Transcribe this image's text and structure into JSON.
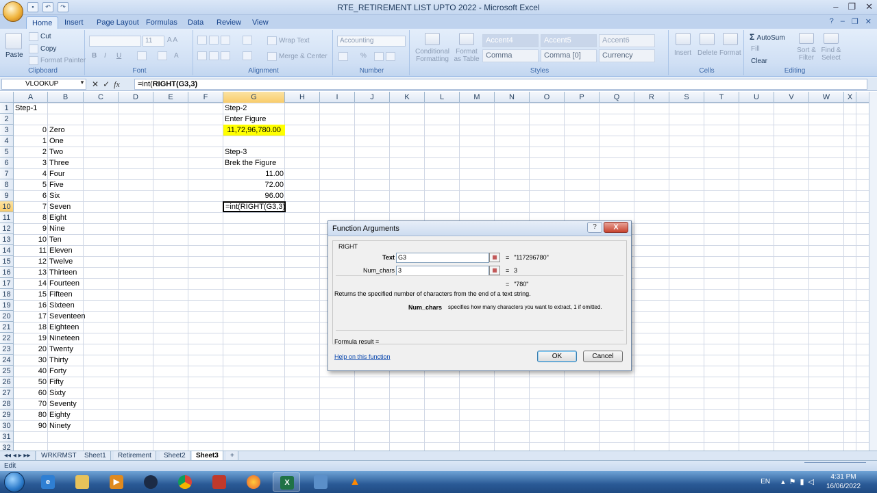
{
  "window": {
    "title": "RTE_RETIREMENT LIST UPTO 2022 - Microsoft Excel",
    "office_button": "Office"
  },
  "ribbon": {
    "tabs": [
      "Home",
      "Insert",
      "Page Layout",
      "Formulas",
      "Data",
      "Review",
      "View"
    ],
    "clipboard": {
      "label": "Clipboard",
      "paste": "Paste",
      "cut": "Cut",
      "copy": "Copy",
      "format_painter": "Format Painter"
    },
    "font": {
      "label": "Font",
      "size": "11"
    },
    "alignment": {
      "label": "Alignment",
      "wrap_text": "Wrap Text",
      "merge_center": "Merge & Center"
    },
    "number": {
      "label": "Number",
      "format": "Accounting",
      "percent": "%"
    },
    "styles": {
      "label": "Styles",
      "conditional": "Conditional Formatting",
      "format_table": "Format as Table",
      "cells": [
        "Accent4",
        "Accent5",
        "Accent6",
        "Comma",
        "Comma [0]",
        "Currency"
      ]
    },
    "cells": {
      "label": "Cells",
      "insert": "Insert",
      "delete": "Delete",
      "format": "Format"
    },
    "editing": {
      "label": "Editing",
      "autosum": "AutoSum",
      "fill": "Fill",
      "clear": "Clear",
      "sort_filter": "Sort & Filter",
      "find_select": "Find & Select"
    }
  },
  "formula_bar": {
    "name_box": "VLOOKUP",
    "fx": "fx",
    "formula_prefix": "=int(",
    "formula_bold": "RIGHT(G3,3)"
  },
  "grid": {
    "columns": [
      "A",
      "B",
      "C",
      "D",
      "E",
      "F",
      "G",
      "H",
      "I",
      "J",
      "K",
      "L",
      "M",
      "N",
      "O",
      "P",
      "Q",
      "R",
      "S",
      "T",
      "U",
      "V",
      "W",
      "X"
    ],
    "rows": [
      "1",
      "2",
      "3",
      "4",
      "5",
      "6",
      "7",
      "8",
      "9",
      "10",
      "11",
      "12",
      "13",
      "14",
      "15",
      "16",
      "17",
      "18",
      "19",
      "20",
      "21",
      "22",
      "23",
      "24",
      "25",
      "26",
      "27",
      "28",
      "29",
      "30",
      "31",
      "32"
    ],
    "col_a": [
      "Step-1",
      "",
      "0",
      "1",
      "2",
      "3",
      "4",
      "5",
      "6",
      "7",
      "8",
      "9",
      "10",
      "11",
      "12",
      "13",
      "14",
      "15",
      "16",
      "17",
      "18",
      "19",
      "20",
      "30",
      "40",
      "50",
      "60",
      "70",
      "80",
      "90"
    ],
    "col_b": [
      "",
      "",
      "Zero",
      "One",
      "Two",
      "Three",
      "Four",
      "Five",
      "Six",
      "Seven",
      "Eight",
      "Nine",
      "Ten",
      "Eleven",
      "Twelve",
      "Thirteen",
      "Fourteen",
      "Fifteen",
      "Sixteen",
      "Seventeen",
      "Eighteen",
      "Nineteen",
      "Twenty",
      "Thirty",
      "Forty",
      "Fifty",
      "Sixty",
      "Seventy",
      "Eighty",
      "Ninety"
    ],
    "g": {
      "g1": "Step-2",
      "g2": "Enter Figure",
      "g3": "11,72,96,780.00",
      "g5": "Step-3",
      "g6": "Brek the Figure",
      "g7": "11.00",
      "g8": "72.00",
      "g9": "96.00",
      "g10": "=int(RIGHT(G3,3)"
    }
  },
  "sheets": {
    "tabs": [
      "WRKRMST",
      "Sheet1",
      "Retirement",
      "Sheet2",
      "Sheet3"
    ],
    "active": "Sheet3"
  },
  "status": {
    "mode": "Edit"
  },
  "dialog": {
    "title": "Function Arguments",
    "function_name": "RIGHT",
    "args": [
      {
        "label": "Text",
        "value": "G3",
        "result": "\"117296780\""
      },
      {
        "label": "Num_chars",
        "value": "3",
        "result": "3"
      }
    ],
    "eq": "=",
    "overall_result": "\"780\"",
    "description": "Returns the specified number of characters from the end of a text string.",
    "arg_help_name": "Num_chars",
    "arg_help_text": "specifies how many characters you want to extract, 1 if omitted.",
    "formula_result_label": "Formula result =",
    "help_link": "Help on this function",
    "ok": "OK",
    "cancel": "Cancel",
    "help_btn": "?",
    "close_btn": "X"
  },
  "taskbar": {
    "language": "EN",
    "time": "4:31 PM",
    "date": "16/06/2022"
  }
}
